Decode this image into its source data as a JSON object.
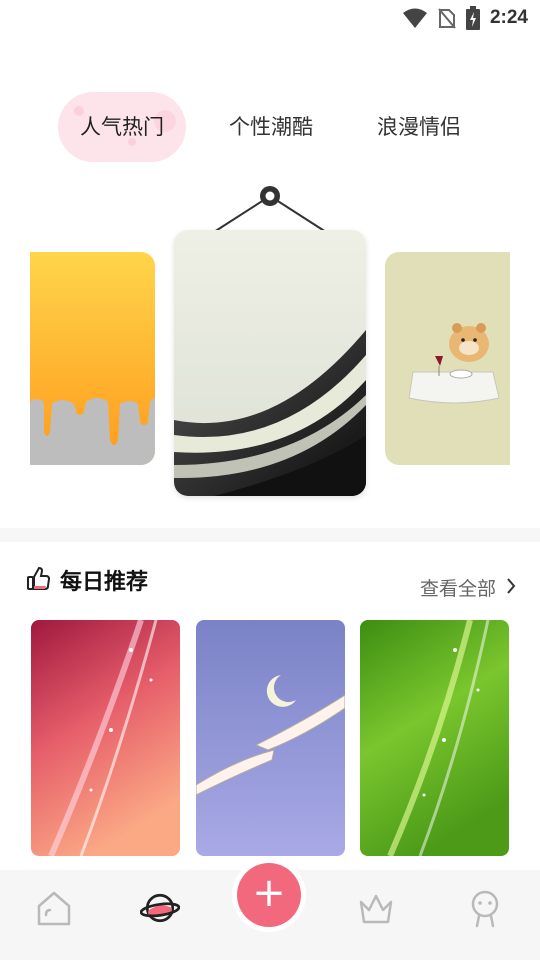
{
  "status_bar": {
    "time": "2:24",
    "icons": [
      "wifi-icon",
      "no-sim-icon",
      "battery-charging-icon"
    ]
  },
  "tabs": [
    {
      "label": "人气热门",
      "active": true
    },
    {
      "label": "个性潮酷",
      "active": false
    },
    {
      "label": "浪漫情侣",
      "active": false
    }
  ],
  "carousel": {
    "items": [
      {
        "name": "orange-paint-drip-wallpaper"
      },
      {
        "name": "white-black-curves-wallpaper"
      },
      {
        "name": "hamster-dining-wallpaper"
      }
    ]
  },
  "daily": {
    "title": "每日推荐",
    "view_all": "查看全部",
    "items": [
      {
        "name": "pink-sparkle-wallpaper"
      },
      {
        "name": "moon-hands-wallpaper"
      },
      {
        "name": "green-sparkle-wallpaper"
      }
    ]
  },
  "nav": {
    "items": [
      "home-icon",
      "planet-icon",
      "add-icon",
      "crown-icon",
      "profile-icon"
    ],
    "fab_label": "+",
    "accent": "#f2697e"
  },
  "colors": {
    "accent_pink": "#f2697e",
    "tab_active_bg": "#fde4ea"
  }
}
